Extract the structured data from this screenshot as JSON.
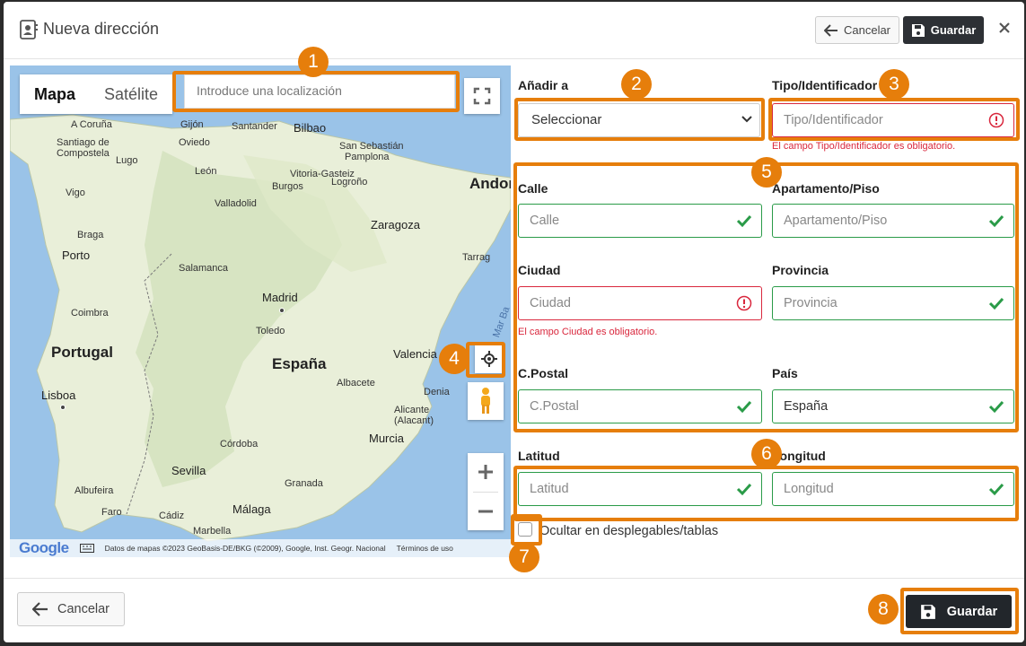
{
  "header": {
    "title": "Nueva dirección",
    "cancel_label": "Cancelar",
    "save_label": "Guardar"
  },
  "map": {
    "tabs": [
      "Mapa",
      "Satélite"
    ],
    "search_placeholder": "Introduce una localización",
    "cities": {
      "coruna": "A Coruña",
      "santiago": "Santiago de Compostela",
      "lugo": "Lugo",
      "oviedo": "Oviedo",
      "gijon": "Gijón",
      "santander": "Santander",
      "bilbao": "Bilbao",
      "sansebastian": "San Sebastián",
      "pamplona": "Pamplona",
      "vitoria": "Vitoria-Gasteiz",
      "leon": "León",
      "vigo": "Vigo",
      "burgos": "Burgos",
      "logrono": "Logroño",
      "andorra": "Andor",
      "braga": "Braga",
      "valladolid": "Valladolid",
      "zaragoza": "Zaragoza",
      "porto": "Porto",
      "salamanca": "Salamanca",
      "tarragona": "Tarrag",
      "madrid": "Madrid",
      "coimbra": "Coimbra",
      "toledo": "Toledo",
      "portugal": "Portugal",
      "espana": "España",
      "valencia": "Valencia",
      "lisboa": "Lisboa",
      "albacete": "Albacete",
      "denia": "Denia",
      "alicante": "Alicante (Alacant)",
      "murcia": "Murcia",
      "cordoba": "Córdoba",
      "sevilla": "Sevilla",
      "granada": "Granada",
      "albufeira": "Albufeira",
      "malaga": "Málaga",
      "faro": "Faro",
      "marbella": "Marbella",
      "cadiz": "Cádiz",
      "mar": "Mar Ba"
    },
    "google_logo": "Google",
    "attribution": "Datos de mapas ©2023 GeoBasis-DE/BKG (©2009), Google, Inst. Geogr. Nacional",
    "terms": "Términos de uso"
  },
  "form": {
    "add_to_label": "Añadir a",
    "add_to_value": "Seleccionar",
    "type_label": "Tipo/Identificador",
    "type_placeholder": "Tipo/Identificador",
    "type_error": "El campo Tipo/Identificador es obligatorio.",
    "street_label": "Calle",
    "street_placeholder": "Calle",
    "apt_label": "Apartamento/Piso",
    "apt_placeholder": "Apartamento/Piso",
    "city_label": "Ciudad",
    "city_placeholder": "Ciudad",
    "city_error": "El campo Ciudad es obligatorio.",
    "province_label": "Provincia",
    "province_placeholder": "Provincia",
    "postal_label": "C.Postal",
    "postal_placeholder": "C.Postal",
    "country_label": "País",
    "country_value": "España",
    "lat_label": "Latitud",
    "lat_placeholder": "Latitud",
    "lng_label": "Longitud",
    "lng_placeholder": "Longitud",
    "hide_label": "Ocultar en desplegables/tablas"
  },
  "footer": {
    "cancel_label": "Cancelar",
    "save_label": "Guardar"
  },
  "badges": [
    "1",
    "2",
    "3",
    "4",
    "5",
    "6",
    "7",
    "8"
  ],
  "colors": {
    "highlight": "#e67e0b",
    "valid": "#2a9b48",
    "invalid": "#d9273d",
    "dark_button": "#22262b"
  }
}
